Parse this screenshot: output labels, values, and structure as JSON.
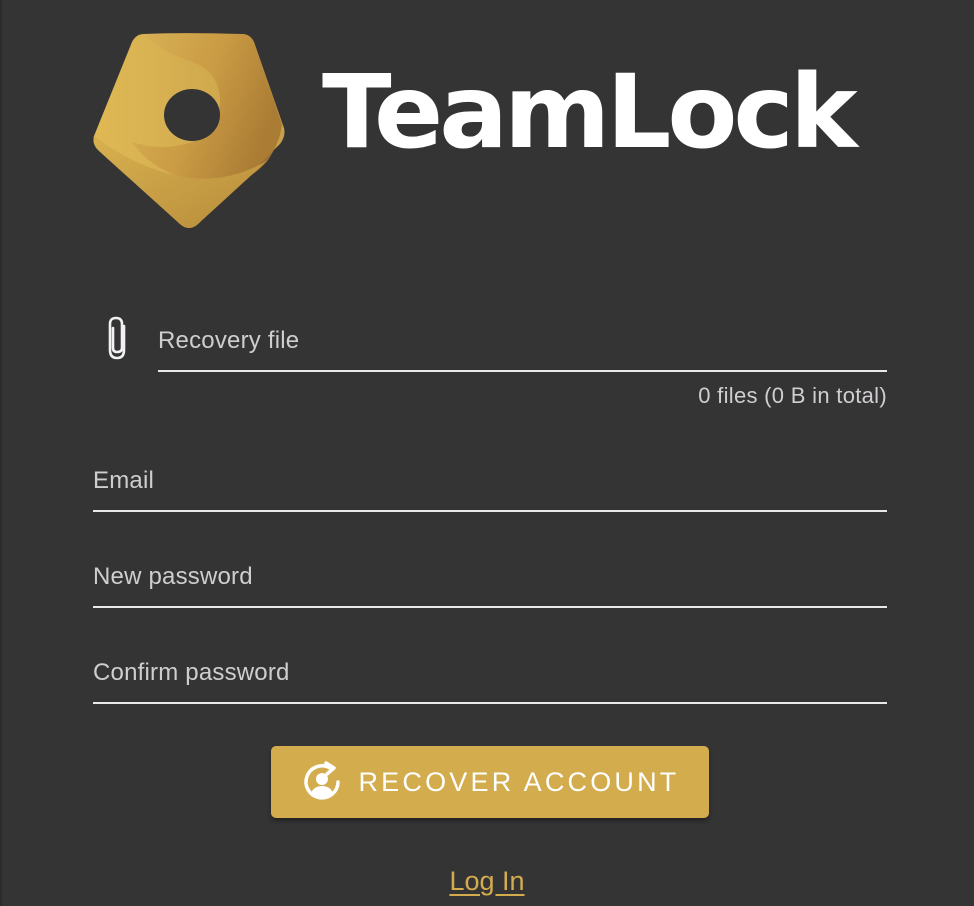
{
  "brand": {
    "name_part1": "TeamL",
    "name_part2": "ck",
    "logo_icon": "pentagon-ribbon-logo",
    "accent_color": "#d3ac4e"
  },
  "form": {
    "recovery_file": {
      "placeholder": "Recovery file",
      "icon": "paperclip-icon",
      "summary": "0 files (0 B in total)"
    },
    "email": {
      "placeholder": "Email",
      "value": ""
    },
    "new_password": {
      "placeholder": "New password",
      "value": ""
    },
    "confirm_password": {
      "placeholder": "Confirm password",
      "value": ""
    },
    "submit": {
      "label": "RECOVER ACCOUNT",
      "icon": "account-recover-icon"
    }
  },
  "footer": {
    "login_link": "Log In"
  }
}
